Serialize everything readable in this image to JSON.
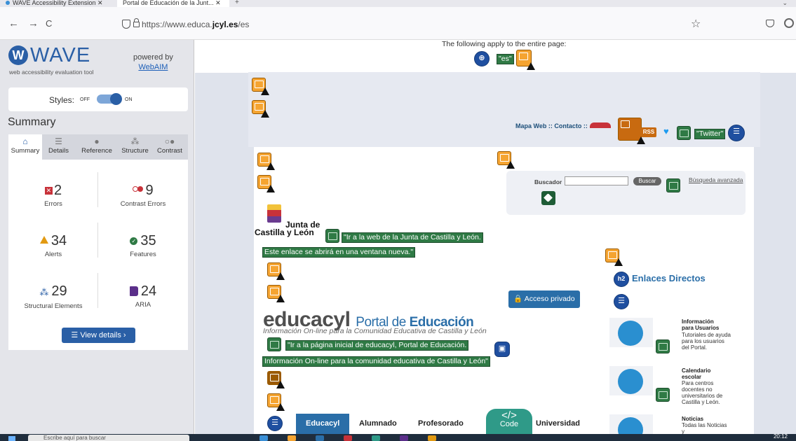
{
  "browser": {
    "tabs": [
      {
        "label": "WAVE Accessibility Extension"
      },
      {
        "label": "Portal de Educación de la Junt..."
      }
    ],
    "new_tab": "+",
    "url_prefix": "https://www.educa.",
    "url_domain": "jcyl.es",
    "url_suffix": "/es",
    "back": "←",
    "forward": "→",
    "reload": "C",
    "bookmark": "☆"
  },
  "wave": {
    "logo": "W",
    "title": "WAVE",
    "subtitle": "web accessibility evaluation tool",
    "powered_by": "powered by",
    "webaim": "WebAIM",
    "styles_label": "Styles:",
    "styles_off": "OFF",
    "styles_on": "ON",
    "summary_heading": "Summary",
    "tabs": [
      {
        "label": "Summary",
        "icon": "home-icon"
      },
      {
        "label": "Details",
        "icon": "list-icon"
      },
      {
        "label": "Reference",
        "icon": "info-icon"
      },
      {
        "label": "Structure",
        "icon": "structure-icon"
      },
      {
        "label": "Contrast",
        "icon": "contrast-icon"
      }
    ],
    "stats": {
      "errors": {
        "count": "2",
        "label": "Errors"
      },
      "contrast": {
        "count": "9",
        "label": "Contrast Errors"
      },
      "alerts": {
        "count": "34",
        "label": "Alerts"
      },
      "features": {
        "count": "35",
        "label": "Features"
      },
      "structural": {
        "count": "29",
        "label": "Structural Elements"
      },
      "aria": {
        "count": "24",
        "label": "ARIA"
      }
    },
    "view_details": "View details ›"
  },
  "page": {
    "applies_text": "The following apply to the entire page:",
    "lang_label": "\"es\"",
    "top_links": "Mapa Web :: Contacto ::",
    "rss": "RSS",
    "twitter_label": "\"Twitter\"",
    "buscador": "Buscador",
    "buscar": "Buscar",
    "busqueda_avanzada": "Búsqueda avanzada",
    "junta_line1": "Junta de",
    "junta_line2": "Castilla y León",
    "junta_alt_1": "\"Ir a la web de la Junta de Castilla y León.",
    "junta_alt_2": "Este enlace se abrirá en una ventana nueva.\"",
    "educacyl": "educacyl",
    "portal_de": "Portal de",
    "educacion": "Educación",
    "edu_sub": "Información On-line para la Comunidad Educativa de Castilla y León",
    "edu_alt_1": "\"Ir a la página inicial de educacyl, Portal de Educación.",
    "edu_alt_2": "Información On-line para la comunidad educativa de Castilla y León\"",
    "acceso": "🔒 Acceso privado",
    "h2_badge": "h2",
    "enlaces": "Enlaces Directos",
    "blocks": [
      {
        "title": "Información para Usuarios",
        "desc": "Tutoriales de ayuda para los usuarios del Portal."
      },
      {
        "title": "Calendario escolar",
        "desc": "Para centros docentes no universitarios de Castilla y León."
      },
      {
        "title": "Noticias",
        "desc": "Todas las Noticias y"
      }
    ],
    "menu": [
      "Educacyl",
      "Alumnado",
      "Profesorado",
      "Universidad"
    ],
    "code_symbol": "</>",
    "code_label": "Code"
  },
  "taskbar": {
    "search_placeholder": "Escribe aquí para buscar",
    "time": "20:12"
  }
}
